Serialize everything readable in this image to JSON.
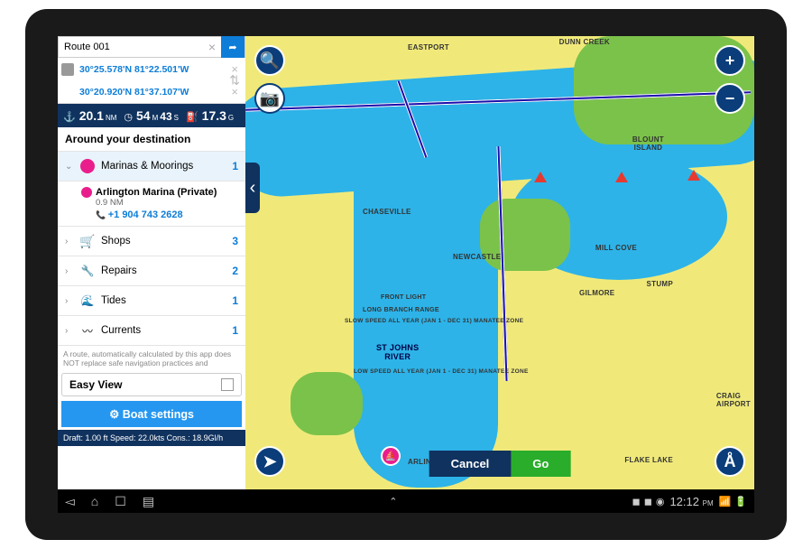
{
  "route_name": "Route 001",
  "waypoints": [
    "30°25.578'N 81°22.501'W",
    "30°20.920'N 81°37.107'W"
  ],
  "stats": {
    "distance_val": "20.1",
    "distance_unit": "NM",
    "time_val": "54",
    "time_sub": "M",
    "time_sec": "43",
    "time_sec_unit": "S",
    "fuel_val": "17.3",
    "fuel_unit": "G"
  },
  "section_title": "Around your destination",
  "categories": [
    {
      "label": "Marinas & Moorings",
      "count": "1",
      "icon": "marina",
      "expanded": true
    },
    {
      "label": "Shops",
      "count": "3",
      "icon": "shop"
    },
    {
      "label": "Repairs",
      "count": "2",
      "icon": "repair"
    },
    {
      "label": "Tides",
      "count": "1",
      "icon": "tides"
    },
    {
      "label": "Currents",
      "count": "1",
      "icon": "currents"
    }
  ],
  "poi": {
    "name": "Arlington Marina (Private)",
    "distance": "0.9 NM",
    "phone": "+1 904 743 2628"
  },
  "disclaimer": "A route, automatically calculated by this app does NOT replace safe navigation practices and",
  "easy_view_label": "Easy View",
  "boat_settings_label": "Boat settings",
  "draft_line": "Draft: 1.00 ft Speed: 22.0kts Cons.: 18.9Gl/h",
  "map_labels": {
    "eastport": "EASTPORT",
    "dunn": "DUNN CREEK",
    "blount": "BLOUNT\nISLAND",
    "chaseville": "CHASEVILLE",
    "newcastle": "NEWCASTLE",
    "gilmore": "GILMORE",
    "stump": "STUMP",
    "millcove": "MILL COVE",
    "stjohns": "ST JOHNS\nRIVER",
    "arlington": "ARLINGTON",
    "flakelake": "FLAKE LAKE",
    "craig": "CRAIG\nAIRPORT",
    "frontlight": "FRONT LIGHT",
    "longbranch": "LONG BRANCH RANGE",
    "manatee1": "SLOW SPEED ALL YEAR (JAN 1 - DEC 31) MANATEE ZONE",
    "manatee2": "LOW SPEED ALL YEAR (JAN 1 - DEC 31) MANATEE ZONE"
  },
  "actions": {
    "cancel": "Cancel",
    "go": "Go"
  },
  "sysbar": {
    "time": "12:12",
    "ampm": "PM"
  }
}
